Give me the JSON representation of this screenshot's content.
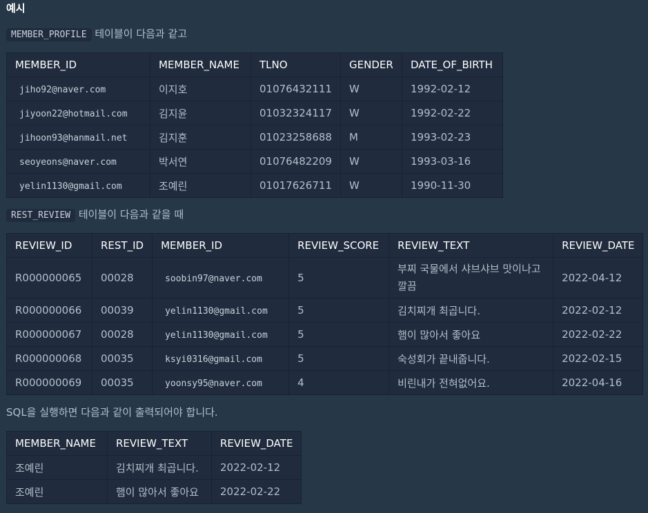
{
  "heading": "예시",
  "intro1": {
    "code": "MEMBER_PROFILE",
    "text": "테이블이 다음과 같고"
  },
  "member_profile": {
    "headers": [
      "MEMBER_ID",
      "MEMBER_NAME",
      "TLNO",
      "GENDER",
      "DATE_OF_BIRTH"
    ],
    "rows": [
      [
        "jiho92@naver.com",
        "이지호",
        "01076432111",
        "W",
        "1992-02-12"
      ],
      [
        "jiyoon22@hotmail.com",
        "김지윤",
        "01032324117",
        "W",
        "1992-02-22"
      ],
      [
        "jihoon93@hanmail.net",
        "김지훈",
        "01023258688",
        "M",
        "1993-02-23"
      ],
      [
        "seoyeons@naver.com",
        "박서연",
        "01076482209",
        "W",
        "1993-03-16"
      ],
      [
        "yelin1130@gmail.com",
        "조예린",
        "01017626711",
        "W",
        "1990-11-30"
      ]
    ]
  },
  "intro2": {
    "code": "REST_REVIEW",
    "text": "테이블이 다음과 같을 때"
  },
  "rest_review": {
    "headers": [
      "REVIEW_ID",
      "REST_ID",
      "MEMBER_ID",
      "REVIEW_SCORE",
      "REVIEW_TEXT",
      "REVIEW_DATE"
    ],
    "rows": [
      [
        "R000000065",
        "00028",
        "soobin97@naver.com",
        "5",
        "부찌 국물에서 샤브샤브 맛이나고 깔끔",
        "2022-04-12"
      ],
      [
        "R000000066",
        "00039",
        "yelin1130@gmail.com",
        "5",
        "김치찌개 최곱니다.",
        "2022-02-12"
      ],
      [
        "R000000067",
        "00028",
        "yelin1130@gmail.com",
        "5",
        "햄이 많아서 좋아요",
        "2022-02-22"
      ],
      [
        "R000000068",
        "00035",
        "ksyi0316@gmail.com",
        "5",
        "숙성회가 끝내줍니다.",
        "2022-02-15"
      ],
      [
        "R000000069",
        "00035",
        "yoonsy95@naver.com",
        "4",
        "비린내가 전혀없어요.",
        "2022-04-16"
      ]
    ]
  },
  "intro3": "SQL을 실행하면 다음과 같이 출력되어야 합니다.",
  "result": {
    "headers": [
      "MEMBER_NAME",
      "REVIEW_TEXT",
      "REVIEW_DATE"
    ],
    "rows": [
      [
        "조예린",
        "김치찌개 최곱니다.",
        "2022-02-12"
      ],
      [
        "조예린",
        "햄이 많아서 좋아요",
        "2022-02-22"
      ]
    ]
  }
}
